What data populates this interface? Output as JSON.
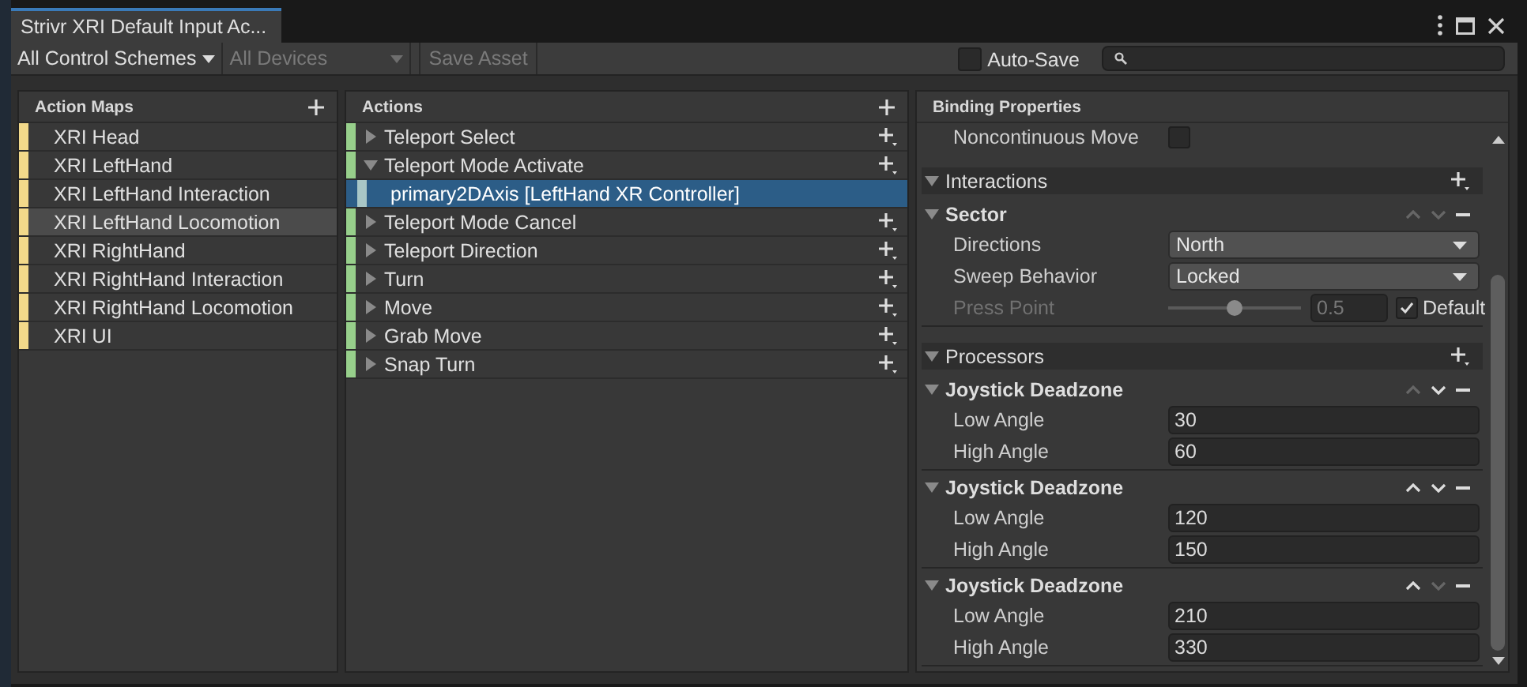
{
  "window": {
    "title": "Strivr XRI Default Input Ac..."
  },
  "toolbar": {
    "control_scheme": {
      "label": "All Control Schemes",
      "disabled": false
    },
    "devices": {
      "label": "All Devices",
      "disabled": true
    },
    "save_button": {
      "label": "Save Asset",
      "disabled": true
    },
    "auto_save": {
      "label": "Auto-Save",
      "checked": false
    }
  },
  "action_maps": {
    "title": "Action Maps",
    "items": [
      {
        "label": "XRI Head",
        "selected": false
      },
      {
        "label": "XRI LeftHand",
        "selected": false
      },
      {
        "label": "XRI LeftHand Interaction",
        "selected": false
      },
      {
        "label": "XRI LeftHand Locomotion",
        "selected": true
      },
      {
        "label": "XRI RightHand",
        "selected": false
      },
      {
        "label": "XRI RightHand Interaction",
        "selected": false
      },
      {
        "label": "XRI RightHand Locomotion",
        "selected": false
      },
      {
        "label": "XRI UI",
        "selected": false
      }
    ]
  },
  "actions": {
    "title": "Actions",
    "items": [
      {
        "label": "Teleport Select",
        "expanded": false,
        "selected": false
      },
      {
        "label": "Teleport Mode Activate",
        "expanded": true,
        "selected": false,
        "children": [
          {
            "label": "primary2DAxis [LeftHand XR Controller]",
            "selected": true
          }
        ]
      },
      {
        "label": "Teleport Mode Cancel",
        "expanded": false,
        "selected": false
      },
      {
        "label": "Teleport Direction",
        "expanded": false,
        "selected": false
      },
      {
        "label": "Turn",
        "expanded": false,
        "selected": false
      },
      {
        "label": "Move",
        "expanded": false,
        "selected": false
      },
      {
        "label": "Grab Move",
        "expanded": false,
        "selected": false
      },
      {
        "label": "Snap Turn",
        "expanded": false,
        "selected": false
      }
    ]
  },
  "binding_properties": {
    "title": "Binding Properties",
    "noncontinuous_move": {
      "label": "Noncontinuous Move",
      "checked": false
    },
    "sections": [
      {
        "title": "Interactions",
        "expanded": true,
        "items": [
          {
            "name": "Sector",
            "expanded": true,
            "up_enabled": false,
            "down_enabled": false,
            "fields": [
              {
                "kind": "dropdown",
                "label": "Directions",
                "value": "North",
                "disabled": false
              },
              {
                "kind": "dropdown",
                "label": "Sweep Behavior",
                "value": "Locked",
                "disabled": false
              },
              {
                "kind": "slider",
                "label": "Press Point",
                "disabled": true,
                "level": 0.5,
                "value": "0.5",
                "default": {
                  "label": "Default",
                  "checked": true
                }
              }
            ]
          }
        ]
      },
      {
        "title": "Processors",
        "expanded": true,
        "items": [
          {
            "name": "Joystick Deadzone",
            "expanded": true,
            "up_enabled": false,
            "down_enabled": true,
            "fields": [
              {
                "kind": "number",
                "label": "Low Angle",
                "value": "30",
                "disabled": false
              },
              {
                "kind": "number",
                "label": "High Angle",
                "value": "60",
                "disabled": false
              }
            ]
          },
          {
            "name": "Joystick Deadzone",
            "expanded": true,
            "up_enabled": true,
            "down_enabled": true,
            "fields": [
              {
                "kind": "number",
                "label": "Low Angle",
                "value": "120",
                "disabled": false
              },
              {
                "kind": "number",
                "label": "High Angle",
                "value": "150",
                "disabled": false
              }
            ]
          },
          {
            "name": "Joystick Deadzone",
            "expanded": true,
            "up_enabled": true,
            "down_enabled": false,
            "fields": [
              {
                "kind": "number",
                "label": "Low Angle",
                "value": "210",
                "disabled": false
              },
              {
                "kind": "number",
                "label": "High Angle",
                "value": "330",
                "disabled": false
              }
            ]
          }
        ]
      }
    ]
  }
}
